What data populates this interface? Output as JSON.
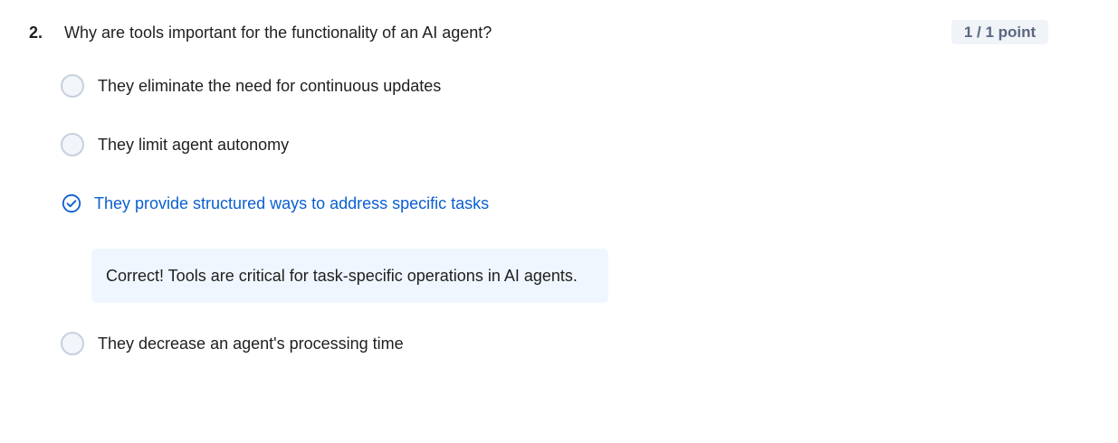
{
  "question": {
    "number": "2.",
    "text": "Why are tools important for the functionality of an AI agent?",
    "score": "1 / 1 point"
  },
  "options": [
    {
      "label": "They eliminate the need for continuous updates",
      "selected": false
    },
    {
      "label": "They limit agent autonomy",
      "selected": false
    },
    {
      "label": "They provide structured ways to address specific tasks",
      "selected": true
    },
    {
      "label": "They decrease an agent's processing time",
      "selected": false
    }
  ],
  "feedback": {
    "text": "Correct! Tools are critical for task-specific operations in AI agents."
  },
  "colors": {
    "selected_text": "#0a5fd0",
    "feedback_bg": "#f0f6ff",
    "radio_border": "#c7d0dd"
  },
  "icons": {
    "selected_option": "check-circle-icon",
    "unselected_option": "radio-empty-icon"
  }
}
